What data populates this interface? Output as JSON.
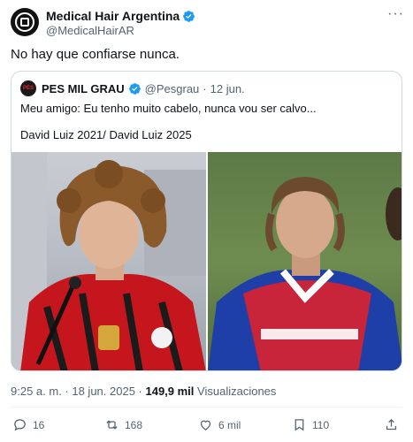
{
  "author": {
    "display_name": "Medical Hair Argentina",
    "handle": "@MedicalHairAR",
    "more_icon": "ellipsis-icon"
  },
  "tweet": {
    "text": "No hay que confiarse nunca."
  },
  "quoted": {
    "display_name": "PES MIL GRAU",
    "handle": "@Pesgrau",
    "separator": "·",
    "date": "12 jun.",
    "line1": "Meu amigo: Eu tenho muito cabelo, nunca vou ser calvo...",
    "line2": "David Luiz 2021/ David Luiz 2025",
    "avatar_text": "PES"
  },
  "meta": {
    "time": "9:25 a. m. · 18 jun. 2025 · ",
    "views_count": "149,9 mil",
    "views_label": " Visualizaciones"
  },
  "actions": {
    "replies": "16",
    "reposts": "168",
    "likes": "6 mil",
    "bookmarks": "110"
  },
  "colors": {
    "verified": "#1d9bf0",
    "muted": "#536471",
    "border": "#cfd9de"
  }
}
